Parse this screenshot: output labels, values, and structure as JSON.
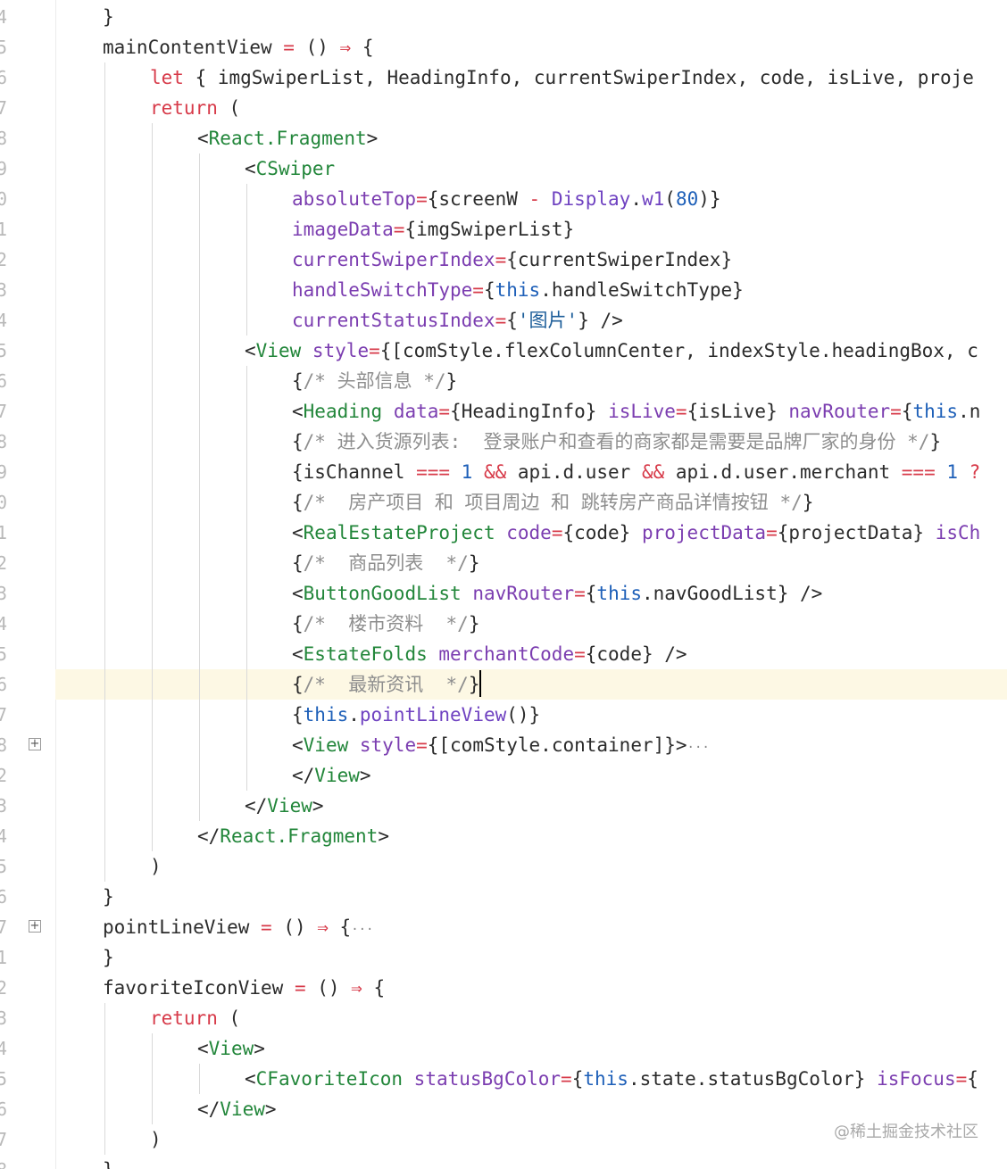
{
  "editor": {
    "lines": [
      {
        "num": "4",
        "indent": 2,
        "tokens": [
          [
            "brk",
            "}"
          ]
        ]
      },
      {
        "num": "5",
        "indent": 2,
        "tokens": [
          [
            "plain",
            "mainContentView "
          ],
          [
            "op",
            "= "
          ],
          [
            "plain",
            "() "
          ],
          [
            "op",
            "⇒ "
          ],
          [
            "plain",
            "{"
          ]
        ]
      },
      {
        "num": "6",
        "indent": 3,
        "tokens": [
          [
            "kw",
            "let "
          ],
          [
            "plain",
            "{ imgSwiperList, HeadingInfo, currentSwiperIndex, code, isLive, proje"
          ]
        ]
      },
      {
        "num": "7",
        "indent": 3,
        "tokens": [
          [
            "kw",
            "return "
          ],
          [
            "plain",
            "("
          ]
        ]
      },
      {
        "num": "8",
        "indent": 4,
        "tokens": [
          [
            "plain",
            "<"
          ],
          [
            "tag",
            "React.Fragment"
          ],
          [
            "plain",
            ">"
          ]
        ]
      },
      {
        "num": "9",
        "indent": 5,
        "tokens": [
          [
            "plain",
            "<"
          ],
          [
            "tag",
            "CSwiper"
          ]
        ]
      },
      {
        "num": "0",
        "indent": 6,
        "tokens": [
          [
            "attr",
            "absoluteTop"
          ],
          [
            "op",
            "="
          ],
          [
            "plain",
            "{screenW "
          ],
          [
            "op",
            "- "
          ],
          [
            "fn",
            "Display"
          ],
          [
            "plain",
            "."
          ],
          [
            "fn",
            "w1"
          ],
          [
            "plain",
            "("
          ],
          [
            "num",
            "80"
          ],
          [
            "plain",
            ")}"
          ]
        ]
      },
      {
        "num": "1",
        "indent": 6,
        "tokens": [
          [
            "attr",
            "imageData"
          ],
          [
            "op",
            "="
          ],
          [
            "plain",
            "{imgSwiperList}"
          ]
        ]
      },
      {
        "num": "2",
        "indent": 6,
        "tokens": [
          [
            "attr",
            "currentSwiperIndex"
          ],
          [
            "op",
            "="
          ],
          [
            "plain",
            "{currentSwiperIndex}"
          ]
        ]
      },
      {
        "num": "3",
        "indent": 6,
        "tokens": [
          [
            "attr",
            "handleSwitchType"
          ],
          [
            "op",
            "="
          ],
          [
            "plain",
            "{"
          ],
          [
            "this",
            "this"
          ],
          [
            "plain",
            ".handleSwitchType}"
          ]
        ]
      },
      {
        "num": "4",
        "indent": 6,
        "tokens": [
          [
            "attr",
            "currentStatusIndex"
          ],
          [
            "op",
            "="
          ],
          [
            "plain",
            "{"
          ],
          [
            "str",
            "'图片'"
          ],
          [
            "plain",
            "} />"
          ]
        ]
      },
      {
        "num": "5",
        "indent": 5,
        "tokens": [
          [
            "plain",
            "<"
          ],
          [
            "tag",
            "View "
          ],
          [
            "attr",
            "style"
          ],
          [
            "op",
            "="
          ],
          [
            "plain",
            "{[comStyle.flexColumnCenter, indexStyle.headingBox, c"
          ]
        ]
      },
      {
        "num": "6",
        "indent": 6,
        "tokens": [
          [
            "plain",
            "{"
          ],
          [
            "cmt",
            "/* 头部信息 */"
          ],
          [
            "plain",
            "}"
          ]
        ]
      },
      {
        "num": "7",
        "indent": 6,
        "tokens": [
          [
            "plain",
            "<"
          ],
          [
            "tag",
            "Heading "
          ],
          [
            "attr",
            "data"
          ],
          [
            "op",
            "="
          ],
          [
            "plain",
            "{HeadingInfo} "
          ],
          [
            "attr",
            "isLive"
          ],
          [
            "op",
            "="
          ],
          [
            "plain",
            "{isLive} "
          ],
          [
            "attr",
            "navRouter"
          ],
          [
            "op",
            "="
          ],
          [
            "plain",
            "{"
          ],
          [
            "this",
            "this"
          ],
          [
            "plain",
            ".n"
          ]
        ]
      },
      {
        "num": "8",
        "indent": 6,
        "tokens": [
          [
            "plain",
            "{"
          ],
          [
            "cmt",
            "/* 进入货源列表:  登录账户和查看的商家都是需要是品牌厂家的身份 */"
          ],
          [
            "plain",
            "}"
          ]
        ]
      },
      {
        "num": "9",
        "indent": 6,
        "tokens": [
          [
            "plain",
            "{isChannel "
          ],
          [
            "op",
            "=== "
          ],
          [
            "num",
            "1 "
          ],
          [
            "op",
            "&& "
          ],
          [
            "plain",
            "api.d.user "
          ],
          [
            "op",
            "&& "
          ],
          [
            "plain",
            "api.d.user.merchant "
          ],
          [
            "op",
            "=== "
          ],
          [
            "num",
            "1 "
          ],
          [
            "op",
            "?"
          ]
        ]
      },
      {
        "num": "0",
        "indent": 6,
        "tokens": [
          [
            "plain",
            "{"
          ],
          [
            "cmt",
            "/*  房产项目 和 项目周边 和 跳转房产商品详情按钮 */"
          ],
          [
            "plain",
            "}"
          ]
        ]
      },
      {
        "num": "1",
        "indent": 6,
        "tokens": [
          [
            "plain",
            "<"
          ],
          [
            "tag",
            "RealEstateProject "
          ],
          [
            "attr",
            "code"
          ],
          [
            "op",
            "="
          ],
          [
            "plain",
            "{code} "
          ],
          [
            "attr",
            "projectData"
          ],
          [
            "op",
            "="
          ],
          [
            "plain",
            "{projectData} "
          ],
          [
            "attr",
            "isCh"
          ]
        ]
      },
      {
        "num": "2",
        "indent": 6,
        "tokens": [
          [
            "plain",
            "{"
          ],
          [
            "cmt",
            "/*  商品列表  */"
          ],
          [
            "plain",
            "}"
          ]
        ]
      },
      {
        "num": "3",
        "indent": 6,
        "tokens": [
          [
            "plain",
            "<"
          ],
          [
            "tag",
            "ButtonGoodList "
          ],
          [
            "attr",
            "navRouter"
          ],
          [
            "op",
            "="
          ],
          [
            "plain",
            "{"
          ],
          [
            "this",
            "this"
          ],
          [
            "plain",
            ".navGoodList} />"
          ]
        ]
      },
      {
        "num": "4",
        "indent": 6,
        "tokens": [
          [
            "plain",
            "{"
          ],
          [
            "cmt",
            "/*  楼市资料  */"
          ],
          [
            "plain",
            "}"
          ]
        ]
      },
      {
        "num": "5",
        "indent": 6,
        "tokens": [
          [
            "plain",
            "<"
          ],
          [
            "tag",
            "EstateFolds "
          ],
          [
            "attr",
            "merchantCode"
          ],
          [
            "op",
            "="
          ],
          [
            "plain",
            "{code} />"
          ]
        ]
      },
      {
        "num": "6",
        "indent": 6,
        "current": true,
        "tokens": [
          [
            "plain",
            "{"
          ],
          [
            "cmt",
            "/*  最新资讯  */"
          ],
          [
            "plain",
            "}"
          ]
        ]
      },
      {
        "num": "7",
        "indent": 6,
        "tokens": [
          [
            "plain",
            "{"
          ],
          [
            "this",
            "this"
          ],
          [
            "plain",
            "."
          ],
          [
            "fn",
            "pointLineView"
          ],
          [
            "plain",
            "()}"
          ]
        ]
      },
      {
        "num": "8",
        "indent": 6,
        "fold": true,
        "tokens": [
          [
            "plain",
            "<"
          ],
          [
            "tag",
            "View "
          ],
          [
            "attr",
            "style"
          ],
          [
            "op",
            "="
          ],
          [
            "plain",
            "{[comStyle.container]}>"
          ],
          [
            "ell",
            "···"
          ]
        ]
      },
      {
        "num": "2",
        "indent": 6,
        "tokens": [
          [
            "plain",
            "</"
          ],
          [
            "tag",
            "View"
          ],
          [
            "plain",
            ">"
          ]
        ]
      },
      {
        "num": "3",
        "indent": 5,
        "tokens": [
          [
            "plain",
            "</"
          ],
          [
            "tag",
            "View"
          ],
          [
            "plain",
            ">"
          ]
        ]
      },
      {
        "num": "4",
        "indent": 4,
        "tokens": [
          [
            "plain",
            "</"
          ],
          [
            "tag",
            "React.Fragment"
          ],
          [
            "plain",
            ">"
          ]
        ]
      },
      {
        "num": "5",
        "indent": 3,
        "tokens": [
          [
            "plain",
            ")"
          ]
        ]
      },
      {
        "num": "6",
        "indent": 2,
        "tokens": [
          [
            "plain",
            "}"
          ]
        ]
      },
      {
        "num": "7",
        "indent": 2,
        "fold": true,
        "tokens": [
          [
            "plain",
            "pointLineView "
          ],
          [
            "op",
            "= "
          ],
          [
            "plain",
            "() "
          ],
          [
            "op",
            "⇒ "
          ],
          [
            "plain",
            "{"
          ],
          [
            "ell",
            "···"
          ]
        ]
      },
      {
        "num": "1",
        "indent": 2,
        "tokens": [
          [
            "plain",
            "}"
          ]
        ]
      },
      {
        "num": "2",
        "indent": 2,
        "tokens": [
          [
            "plain",
            "favoriteIconView "
          ],
          [
            "op",
            "= "
          ],
          [
            "plain",
            "() "
          ],
          [
            "op",
            "⇒ "
          ],
          [
            "plain",
            "{"
          ]
        ]
      },
      {
        "num": "3",
        "indent": 3,
        "tokens": [
          [
            "kw",
            "return "
          ],
          [
            "plain",
            "("
          ]
        ]
      },
      {
        "num": "4",
        "indent": 4,
        "tokens": [
          [
            "plain",
            "<"
          ],
          [
            "tag",
            "View"
          ],
          [
            "plain",
            ">"
          ]
        ]
      },
      {
        "num": "5",
        "indent": 5,
        "tokens": [
          [
            "plain",
            "<"
          ],
          [
            "tag",
            "CFavoriteIcon "
          ],
          [
            "attr",
            "statusBgColor"
          ],
          [
            "op",
            "="
          ],
          [
            "plain",
            "{"
          ],
          [
            "this",
            "this"
          ],
          [
            "plain",
            ".state.statusBgColor} "
          ],
          [
            "attr",
            "isFocus"
          ],
          [
            "op",
            "="
          ],
          [
            "plain",
            "{"
          ]
        ]
      },
      {
        "num": "6",
        "indent": 4,
        "tokens": [
          [
            "plain",
            "</"
          ],
          [
            "tag",
            "View"
          ],
          [
            "plain",
            ">"
          ]
        ]
      },
      {
        "num": "7",
        "indent": 3,
        "tokens": [
          [
            "plain",
            ")"
          ]
        ]
      },
      {
        "num": "8",
        "indent": 2,
        "tokens": [
          [
            "plain",
            "}"
          ]
        ]
      }
    ]
  },
  "watermark": "@稀土掘金技术社区"
}
